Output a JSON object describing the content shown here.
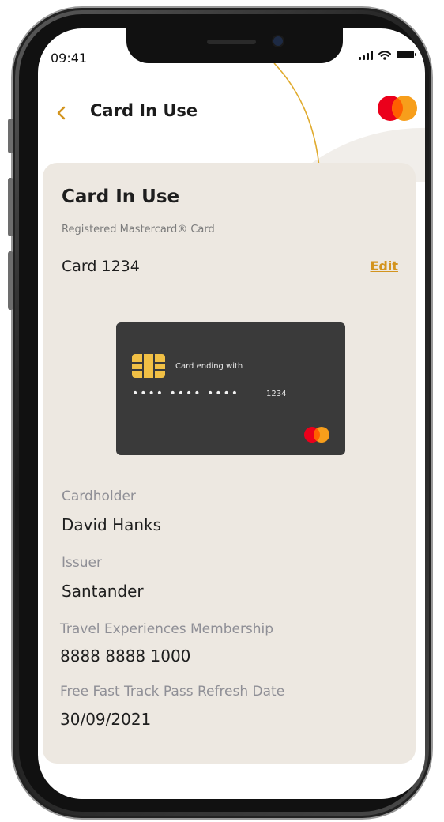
{
  "status_bar": {
    "time": "09:41"
  },
  "nav": {
    "title": "Card In Use"
  },
  "card_section": {
    "title": "Card In Use",
    "subtitle": "Registered Mastercard® Card",
    "card_name": "Card 1234",
    "edit_label": "Edit",
    "card_visual": {
      "ending_label": "Card ending with",
      "masked_number": "•••• •••• ••••",
      "last4": "1234"
    }
  },
  "details": {
    "cardholder_label": "Cardholder",
    "cardholder_value": "David Hanks",
    "issuer_label": "Issuer",
    "issuer_value": "Santander",
    "membership_label": "Travel Experiences Membership",
    "membership_value": "8888 8888 1000",
    "refresh_label": "Free Fast Track Pass Refresh Date",
    "refresh_value": "30/09/2021"
  },
  "colors": {
    "accent": "#d3941e",
    "panel_bg": "#ede8e1",
    "card_bg": "#3a3a3a",
    "mastercard_red": "#eb001b",
    "mastercard_orange": "#f79e1b",
    "chip": "#f1c045"
  },
  "icons": {
    "back": "chevron-left-icon",
    "signal": "signal-icon",
    "wifi": "wifi-icon",
    "battery": "battery-icon",
    "brand": "mastercard-logo"
  }
}
